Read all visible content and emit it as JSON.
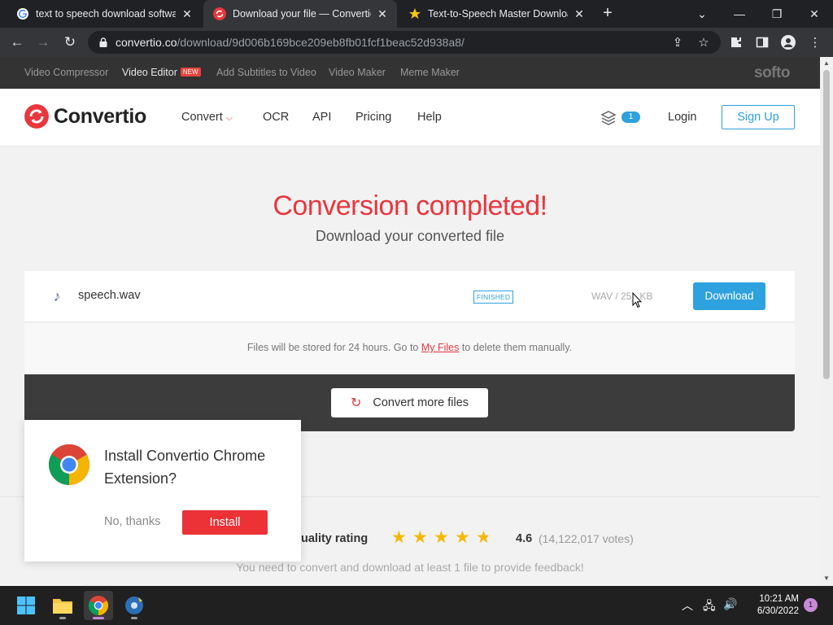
{
  "browser": {
    "tabs": [
      {
        "title": "text to speech download softwar"
      },
      {
        "title": "Download your file — Convertio"
      },
      {
        "title": "Text-to-Speech Master Downloac"
      }
    ],
    "url_domain": "convertio.co",
    "url_path": "/download/9d006b169bce209eb8fb01fcf1beac52d938a8/"
  },
  "softo_bar": {
    "links": [
      "Video Compressor",
      "Video Editor",
      "Add Subtitles to Video",
      "Video Maker",
      "Meme Maker"
    ],
    "new_badge": "NEW",
    "brand": "softo"
  },
  "header": {
    "logo": "Convertio",
    "menu": [
      "Convert",
      "OCR",
      "API",
      "Pricing",
      "Help"
    ],
    "badge_count": "1",
    "login": "Login",
    "signup": "Sign Up"
  },
  "hero": {
    "title": "Conversion completed!",
    "subtitle": "Download your converted file"
  },
  "file": {
    "name": "speech.wav",
    "status": "FINISHED",
    "meta": "WAV / 25_ KB",
    "download": "Download"
  },
  "store_note": {
    "before": "Files will be stored for 24 hours. Go to ",
    "link": "My Files",
    "after": " to delete them manually."
  },
  "convert_more": "Convert more files",
  "rating": {
    "label": "uality rating",
    "score": "4.6",
    "votes": "(14,122,017 votes)",
    "stars": 4.6,
    "note": "You need to convert and download at least 1 file to provide feedback!"
  },
  "extension_popup": {
    "title": "Install Convertio Chrome Extension?",
    "no_thanks": "No, thanks",
    "install": "Install"
  },
  "taskbar": {
    "time": "10:21 AM",
    "date": "6/30/2022",
    "notifications": "1"
  },
  "colors": {
    "brand_red": "#e8373d",
    "accent_blue": "#2ea1df",
    "star": "#f5b800"
  }
}
